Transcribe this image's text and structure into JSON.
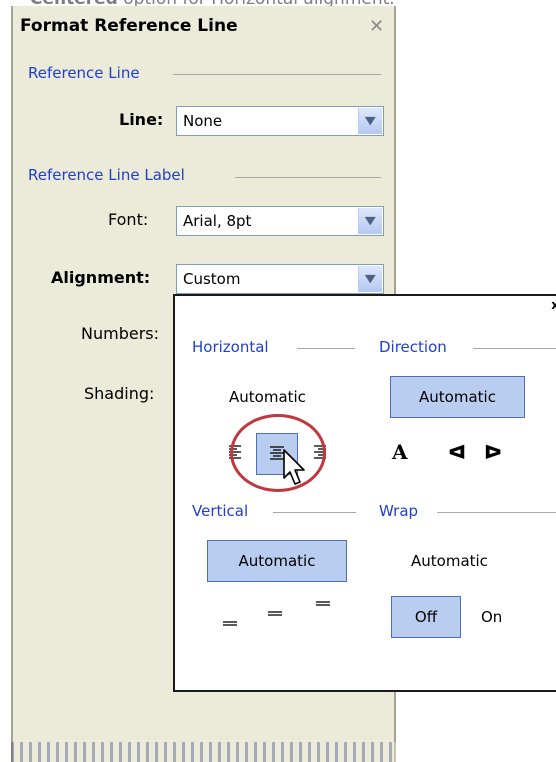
{
  "caption": {
    "bold": "Centered",
    "rest": " option for Horizontal alignment."
  },
  "panel": {
    "title": "Format Reference Line",
    "close_glyph": "✕",
    "section_line": "Reference Line",
    "line_label": "Line:",
    "line_value": "None",
    "section_label": "Reference Line Label",
    "font_label": "Font:",
    "font_value": "Arial, 8pt",
    "alignment_label": "Alignment:",
    "alignment_value": "Custom",
    "numbers_label": "Numbers:",
    "shading_label": "Shading:"
  },
  "popup": {
    "close_glyph": "x",
    "horizontal_label": "Horizontal",
    "horizontal_auto": "Automatic",
    "horizontal_options": [
      "left-align-icon",
      "center-align-icon",
      "right-align-icon"
    ],
    "horizontal_selected": "center-align-icon",
    "direction_label": "Direction",
    "direction_auto": "Automatic",
    "direction_glyph_1": "A",
    "direction_glyph_2": "ᐊ",
    "direction_glyph_3": "ᐅ",
    "vertical_label": "Vertical",
    "vertical_auto": "Automatic",
    "vertical_options": [
      "bottom-align-icon",
      "middle-align-icon",
      "top-align-icon"
    ],
    "wrap_label": "Wrap",
    "wrap_auto": "Automatic",
    "wrap_off": "Off",
    "wrap_on": "On",
    "wrap_selected": "Off"
  },
  "colors": {
    "accent_blue": "#1e3fd0",
    "selected_fill": "#b9cdf0",
    "panel_bg": "#ecead8",
    "highlight_circle": "#c0373e"
  }
}
